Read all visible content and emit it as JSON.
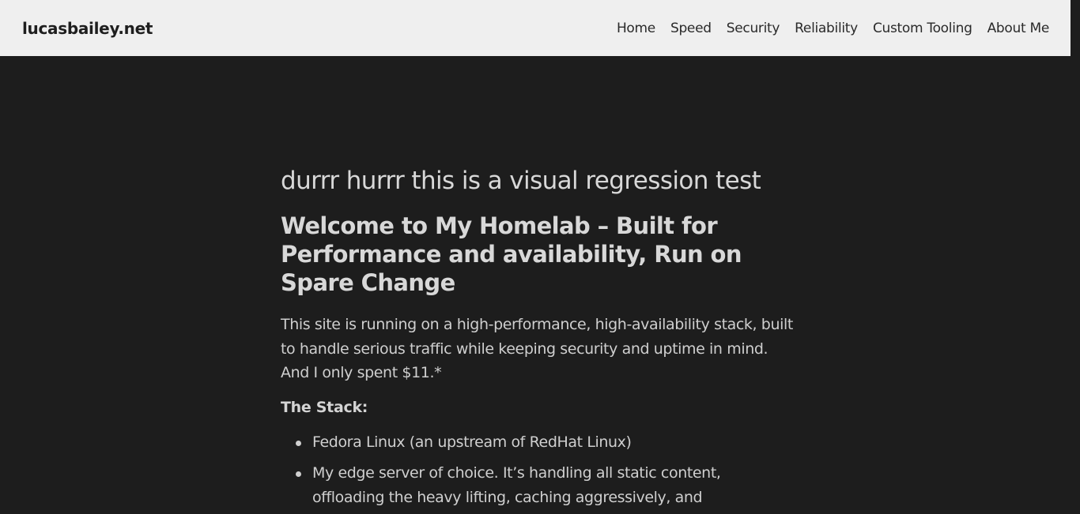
{
  "navbar": {
    "brand": "lucasbailey.net",
    "links": [
      {
        "label": "Home"
      },
      {
        "label": "Speed"
      },
      {
        "label": "Security"
      },
      {
        "label": "Reliability"
      },
      {
        "label": "Custom Tooling"
      },
      {
        "label": "About Me"
      }
    ]
  },
  "main": {
    "test_heading": "durrr hurrr this is a visual regression test",
    "title": "Welcome to My Homelab – Built for Performance and availability, Run on Spare Change",
    "intro": "This site is running on a high-performance, high-availability stack, built to handle serious traffic while keeping security and uptime in mind. And I only spent $11.*",
    "stack_heading": "The Stack:",
    "stack_items": [
      {
        "text": "Fedora Linux (an upstream of RedHat Linux)"
      },
      {
        "text": "My edge server of choice. It’s handling all static content, offloading the heavy lifting, caching aggressively, and"
      }
    ]
  },
  "colors": {
    "navbar_bg": "#efefef",
    "page_bg": "#1d1d1d",
    "text": "#d6d6d6"
  }
}
